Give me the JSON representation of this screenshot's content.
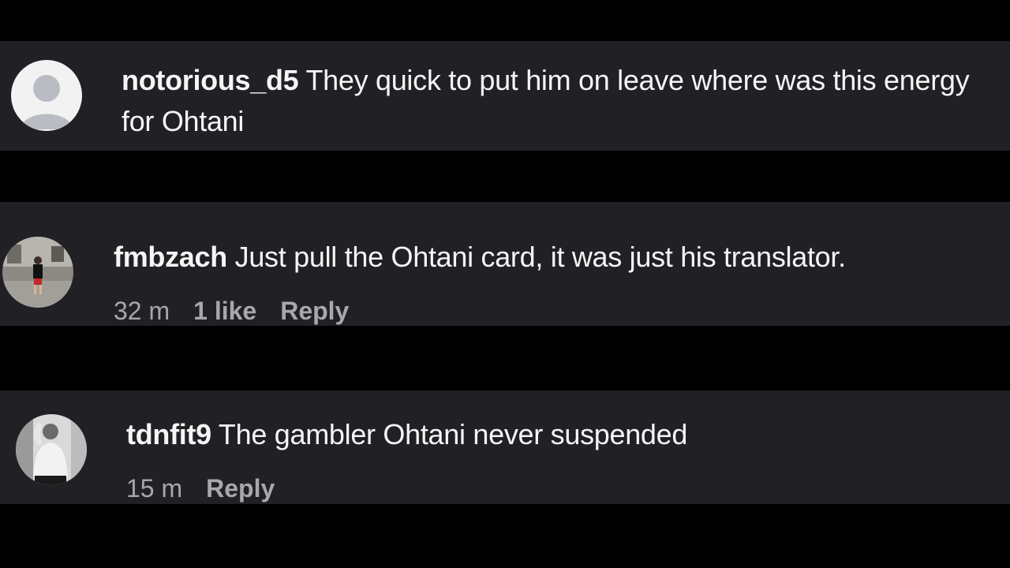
{
  "comments": [
    {
      "username": "notorious_d5",
      "text": " They quick to put him on leave where was this energy for Ohtani",
      "avatar": "default-avatar-icon"
    },
    {
      "username": "fmbzach",
      "text": " Just pull the Ohtani card, it was just his translator.",
      "time": "32 m",
      "likes": "1 like",
      "reply": "Reply",
      "avatar": "user-photo-avatar"
    },
    {
      "username": "tdnfit9",
      "text": " The gambler Ohtani never suspended",
      "time": "15 m",
      "reply": "Reply",
      "avatar": "user-photo-avatar"
    }
  ],
  "colors": {
    "page_background": "#000000",
    "card_background": "#212125",
    "text": "#f5f5f5",
    "meta_text": "#a8a8ac"
  }
}
